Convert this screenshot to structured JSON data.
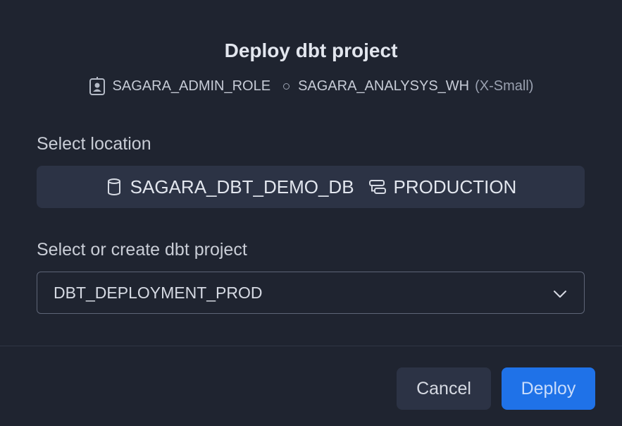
{
  "dialog": {
    "title": "Deploy dbt project",
    "role": "SAGARA_ADMIN_ROLE",
    "warehouse": "SAGARA_ANALYSYS_WH",
    "warehouse_size": "(X-Small)"
  },
  "location": {
    "label": "Select location",
    "database": "SAGARA_DBT_DEMO_DB",
    "schema": "PRODUCTION",
    "database_icon": "database-icon",
    "schema_icon": "schema-icon"
  },
  "project": {
    "label": "Select or create dbt project",
    "selected": "DBT_DEPLOYMENT_PROD",
    "dropdown_icon": "chevron-down-icon"
  },
  "footer": {
    "cancel_label": "Cancel",
    "deploy_label": "Deploy"
  },
  "colors": {
    "background": "#1f2430",
    "panel": "#2c3345",
    "accent": "#1f72e8"
  }
}
